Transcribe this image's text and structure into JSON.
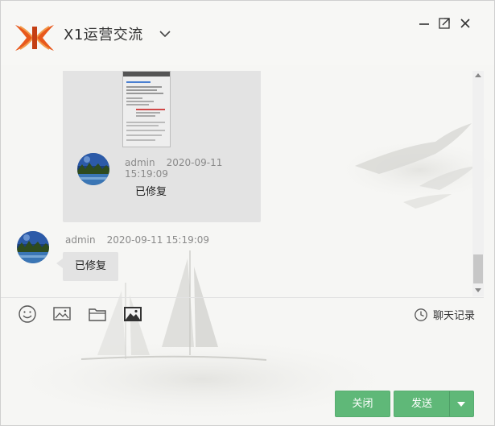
{
  "window": {
    "title": "X1运营交流"
  },
  "messages": [
    {
      "sender": "admin",
      "timestamp": "2020-09-11 15:19:09",
      "text": "已修复"
    },
    {
      "sender": "admin",
      "timestamp": "2020-09-11 15:19:09",
      "text": "已修复"
    }
  ],
  "toolbar": {
    "icons": [
      "smiley-icon",
      "image-icon",
      "folder-icon",
      "picture-icon"
    ],
    "history_label": "聊天记录"
  },
  "actions": {
    "close_label": "关闭",
    "send_label": "发送"
  },
  "colors": {
    "accent_green": "#5fb878",
    "logo_orange": "#e8581c",
    "bubble_gray": "#e3e3e3"
  }
}
